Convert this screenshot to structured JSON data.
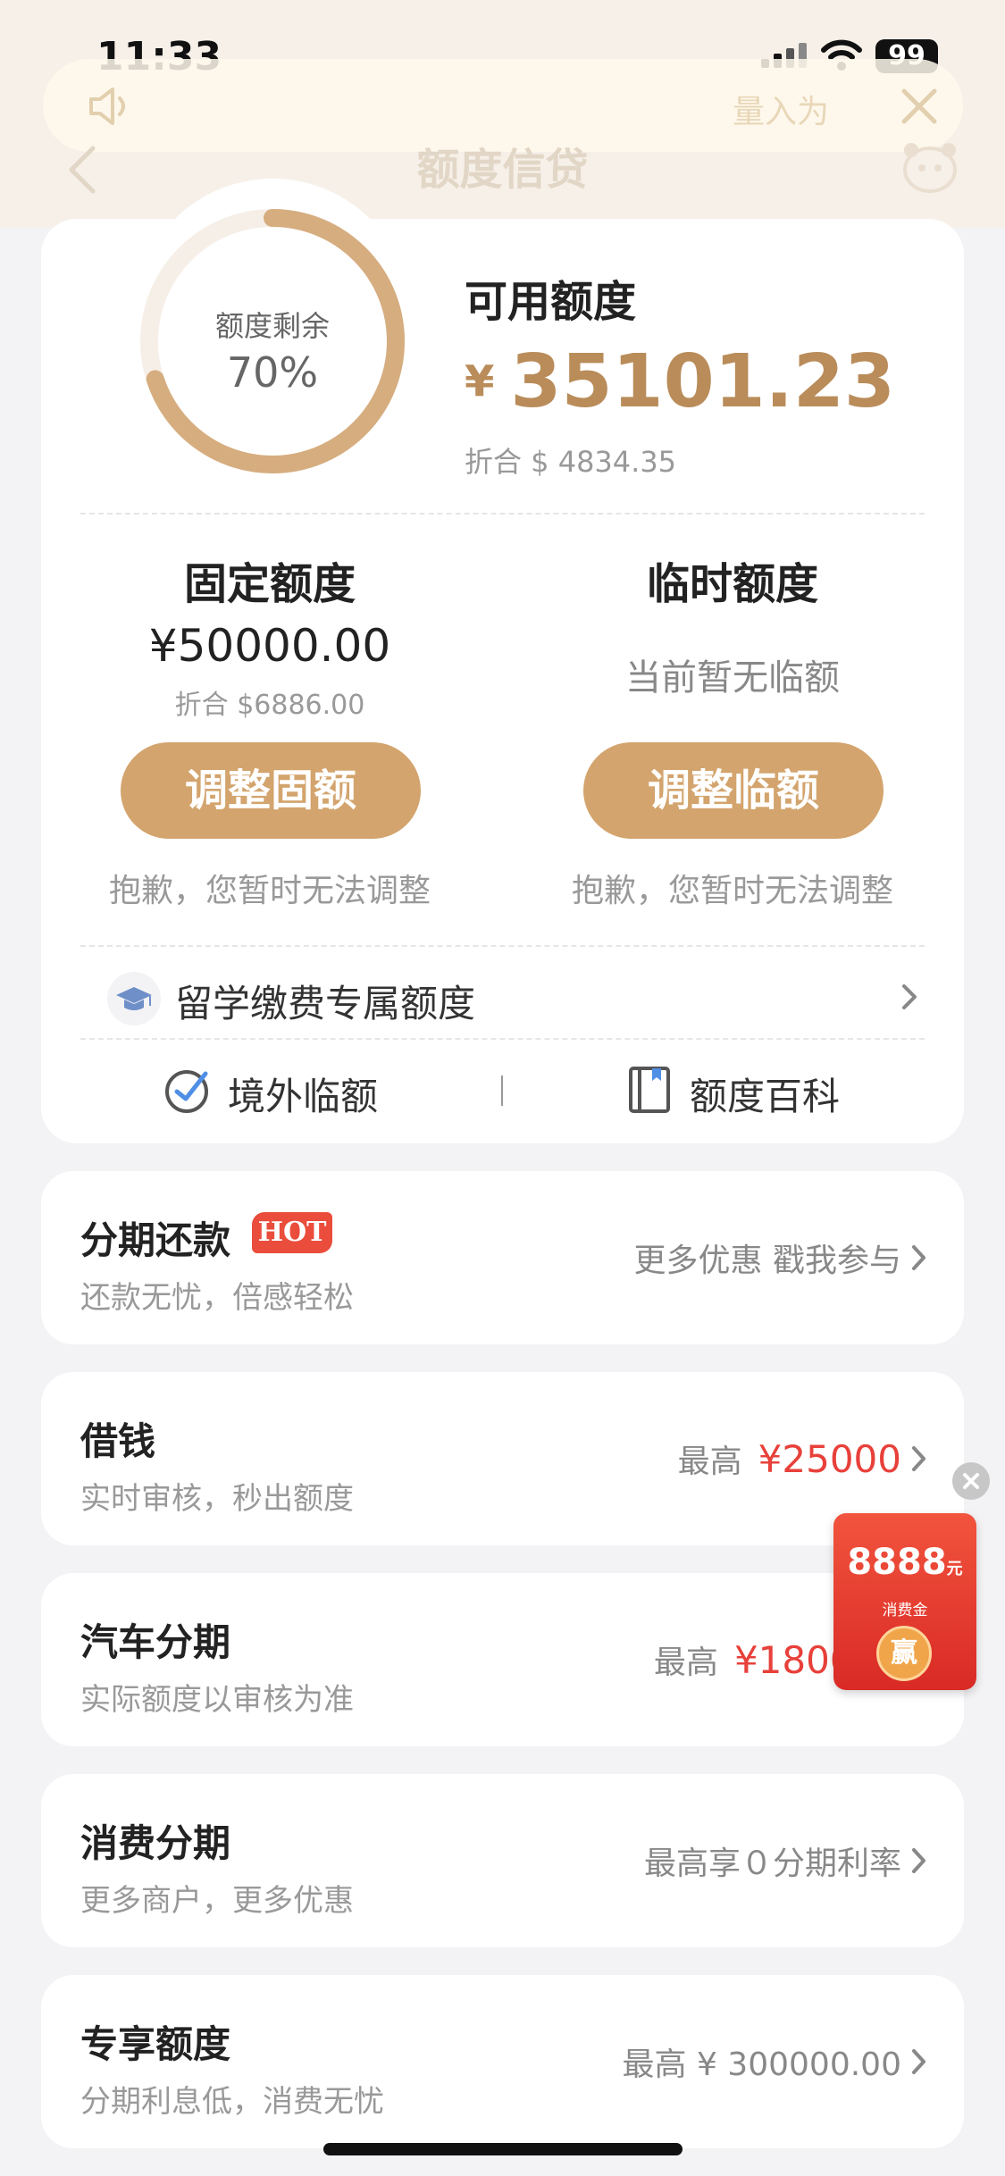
{
  "status_bar": {
    "time": "11:33",
    "battery": "99"
  },
  "notice": {
    "text": "量入为"
  },
  "nav": {
    "title": "额度信贷"
  },
  "credit": {
    "ring_label": "额度剩余",
    "ring_percent": "70%",
    "ring_fraction": 0.7,
    "available_title": "可用额度",
    "currency": "¥",
    "available_amount": "35101.23",
    "available_converted": "折合 $ 4834.35"
  },
  "fixed": {
    "title": "固定额度",
    "amount": "¥50000.00",
    "converted": "折合 $6886.00",
    "button": "调整固额",
    "note": "抱歉，您暂时无法调整"
  },
  "temporary": {
    "title": "临时额度",
    "status": "当前暂无临额",
    "button": "调整临额",
    "note": "抱歉，您暂时无法调整"
  },
  "study_abroad": {
    "label": "留学缴费专属额度"
  },
  "quick_links": [
    {
      "label": "境外临额",
      "icon": "globe-plane-icon"
    },
    {
      "label": "额度百科",
      "icon": "book-icon"
    }
  ],
  "list": [
    {
      "title": "分期还款",
      "badge": "HOT",
      "subtitle": "还款无忧，倍感轻松",
      "right_prefix": "更多优惠 戳我参与",
      "right_value": ""
    },
    {
      "title": "借钱",
      "subtitle": "实时审核，秒出额度",
      "right_prefix": "最高",
      "right_value": "¥25000"
    },
    {
      "title": "汽车分期",
      "subtitle": "实际额度以审核为准",
      "right_prefix": "最高",
      "right_value": "¥180000"
    },
    {
      "title": "消费分期",
      "subtitle": "更多商户，更多优惠",
      "right_prefix": "最高享０分期利率",
      "right_value": ""
    },
    {
      "title": "专享额度",
      "subtitle": "分期利息低，消费无忧",
      "right_prefix": "最高 ¥ 300000.00",
      "right_value": ""
    }
  ],
  "promo": {
    "amount": "8888",
    "unit": "元",
    "label": "消费金",
    "action": "赢"
  },
  "colors": {
    "accent_gold": "#b98c5a",
    "button_gold": "#d3a46d",
    "highlight_red": "#e8403a"
  }
}
